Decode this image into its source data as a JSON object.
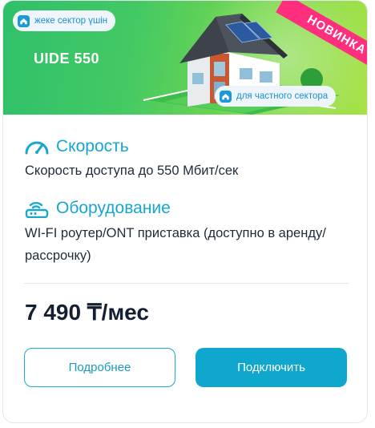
{
  "banner": {
    "pill_kz": "жеке сектор үшін",
    "pill_ru": "для частного сектора",
    "tariff_name": "UIDE 550",
    "ribbon": "НОВИНКА"
  },
  "speed": {
    "title": "Скорость",
    "description": "Скорость доступа до 550 Мбит/сек"
  },
  "equipment": {
    "title": "Оборудование",
    "description": "WI-FI роутер/ONT приставка (доступно в аренду/рассрочку)"
  },
  "price": "7 490 ₸/мес",
  "buttons": {
    "more": "Подробнее",
    "connect": "Подключить"
  },
  "colors": {
    "accent": "#17a7cd",
    "ribbon": "#ff2f7e",
    "banner": "#43c964"
  },
  "icons": {
    "pill": "house-icon",
    "speed": "speedometer-icon",
    "equipment": "router-icon"
  }
}
